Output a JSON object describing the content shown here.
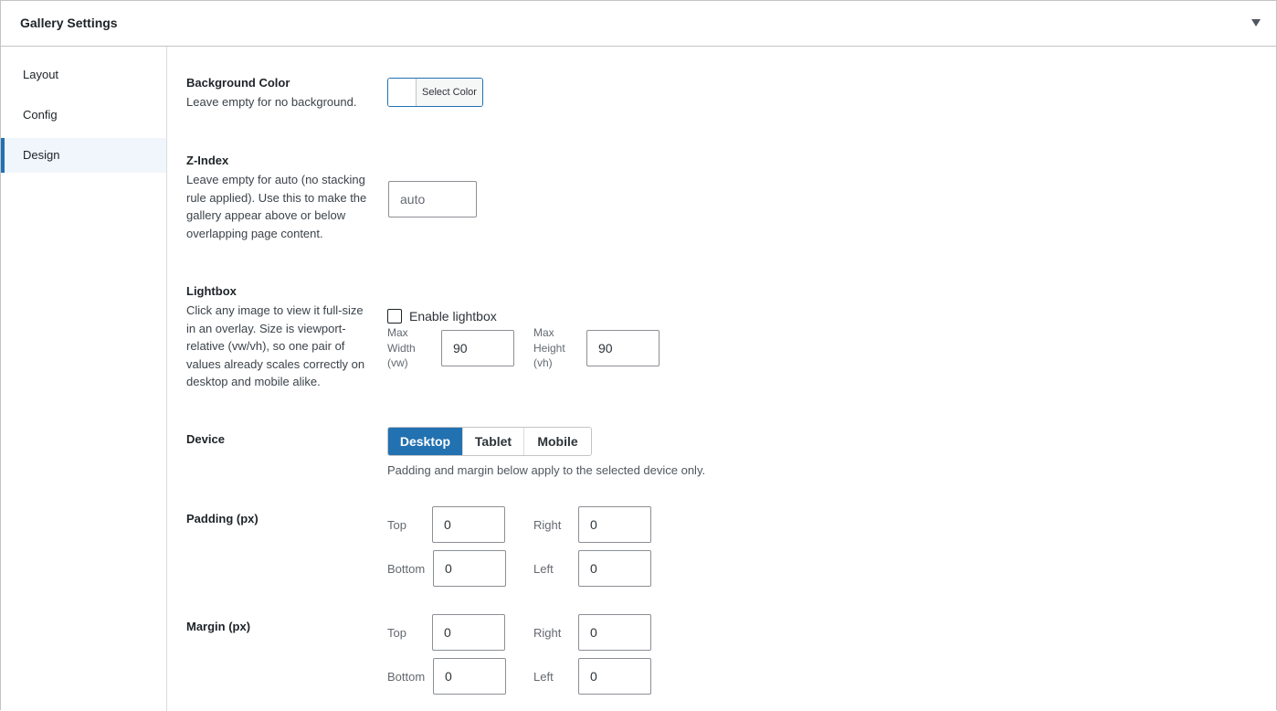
{
  "header": {
    "title": "Gallery Settings",
    "toggle_icon": "triangle-down-icon"
  },
  "sidebar": {
    "items": [
      {
        "label": "Layout"
      },
      {
        "label": "Config"
      },
      {
        "label": "Design",
        "active": true
      }
    ]
  },
  "background": {
    "label": "Background Color",
    "desc": "Leave empty for no background.",
    "button_label": "Select Color"
  },
  "zindex": {
    "label": "Z-Index",
    "desc": "Leave empty for auto (no stacking rule applied). Use this to make the gallery appear above or below overlapping page content.",
    "placeholder": "auto",
    "value": ""
  },
  "lightbox": {
    "label": "Lightbox",
    "desc": "Click any image to view it full-size in an overlay. Size is viewport-relative (vw/vh), so one pair of values already scales correctly on desktop and mobile alike.",
    "checkbox_label": "Enable lightbox",
    "checked": false,
    "max_width_label": "Max Width (vw)",
    "max_width_value": "90",
    "max_height_label": "Max Height (vh)",
    "max_height_value": "90"
  },
  "device": {
    "label": "Device",
    "options": [
      "Desktop",
      "Tablet",
      "Mobile"
    ],
    "selected": "Desktop",
    "help": "Padding and margin below apply to the selected device only."
  },
  "padding": {
    "label": "Padding (px)",
    "top_label": "Top",
    "top": "0",
    "right_label": "Right",
    "right": "0",
    "bottom_label": "Bottom",
    "bottom": "0",
    "left_label": "Left",
    "left": "0"
  },
  "margin": {
    "label": "Margin (px)",
    "top_label": "Top",
    "top": "0",
    "right_label": "Right",
    "right": "0",
    "bottom_label": "Bottom",
    "bottom": "0",
    "left_label": "Left",
    "left": "0"
  },
  "colors": {
    "accent": "#2271b1",
    "active_nav_bg": "#f0f6fc",
    "border": "#c3c4c7"
  }
}
